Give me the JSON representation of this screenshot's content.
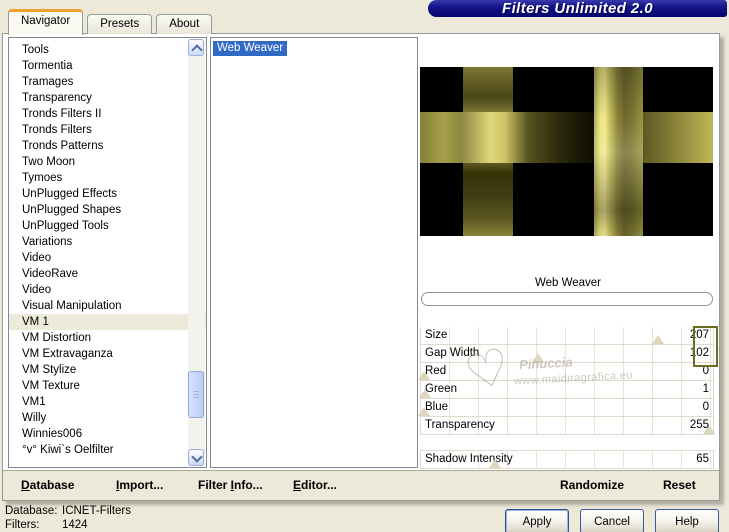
{
  "window": {
    "title": "Filters Unlimited 2.0"
  },
  "tabs": [
    {
      "label": "Navigator",
      "active": true
    },
    {
      "label": "Presets"
    },
    {
      "label": "About"
    }
  ],
  "category_list": {
    "items": [
      {
        "label": "Tools"
      },
      {
        "label": "Tormentia"
      },
      {
        "label": "Tramages"
      },
      {
        "label": "Transparency"
      },
      {
        "label": "Tronds Filters II"
      },
      {
        "label": "Tronds Filters"
      },
      {
        "label": "Tronds Patterns"
      },
      {
        "label": "Two Moon"
      },
      {
        "label": "Tymoes"
      },
      {
        "label": "UnPlugged Effects"
      },
      {
        "label": "UnPlugged Shapes"
      },
      {
        "label": "UnPlugged Tools"
      },
      {
        "label": "Variations"
      },
      {
        "label": "Video"
      },
      {
        "label": "VideoRave"
      },
      {
        "label": "Video"
      },
      {
        "label": "Visual Manipulation"
      },
      {
        "label": "VM 1",
        "selected": true
      },
      {
        "label": "VM Distortion"
      },
      {
        "label": "VM Extravaganza"
      },
      {
        "label": "VM Stylize"
      },
      {
        "label": "VM Texture"
      },
      {
        "label": "VM1"
      },
      {
        "label": "Willy"
      },
      {
        "label": "Winnies006"
      },
      {
        "label": "°v° Kiwi`s Oelfilter"
      }
    ]
  },
  "filter_list": {
    "items": [
      {
        "label": "Web Weaver",
        "selected": true
      }
    ]
  },
  "preview": {
    "filter_name": "Web Weaver"
  },
  "sliders": [
    {
      "label": "Size",
      "value": 207,
      "pct": 81.2
    },
    {
      "label": "Gap Width",
      "value": 102,
      "pct": 40
    },
    {
      "label": "Red",
      "value": 0,
      "pct": 1
    },
    {
      "label": "Green",
      "value": 1,
      "pct": 1.4
    },
    {
      "label": "Blue",
      "value": 0,
      "pct": 1
    },
    {
      "label": "Transparency",
      "value": 255,
      "pct": 98.5
    },
    {
      "label": "Shadow Intensity",
      "value": 65,
      "pct": 25.5,
      "gap_before": true
    }
  ],
  "toolbar": {
    "buttons": [
      {
        "pre": "",
        "u": "D",
        "post": "atabase"
      },
      {
        "pre": "",
        "u": "I",
        "post": "mport..."
      },
      {
        "pre": "Filter ",
        "u": "I",
        "post": "nfo..."
      },
      {
        "pre": "",
        "u": "E",
        "post": "ditor..."
      }
    ],
    "randomize": "Randomize",
    "reset": "Reset"
  },
  "status": {
    "database_label": "Database:",
    "database_value": "ICNET-Filters",
    "filters_label": "Filters:",
    "filters_value": "1424"
  },
  "dialog_buttons": {
    "apply": "Apply",
    "cancel": "Cancel",
    "help": "Help"
  },
  "watermark": {
    "heart": "♡",
    "name": "Pinuccia",
    "url": "www.maidiragrafica.eu"
  },
  "colors": {
    "selection_blue": "#316ac5",
    "title_navy": "#0b0b7d",
    "tab_accent_orange": "#f0a030",
    "annotation_olive": "#6c6c1f",
    "gold_mid": "#cfc766",
    "dialog_beige": "#ece9d8"
  }
}
